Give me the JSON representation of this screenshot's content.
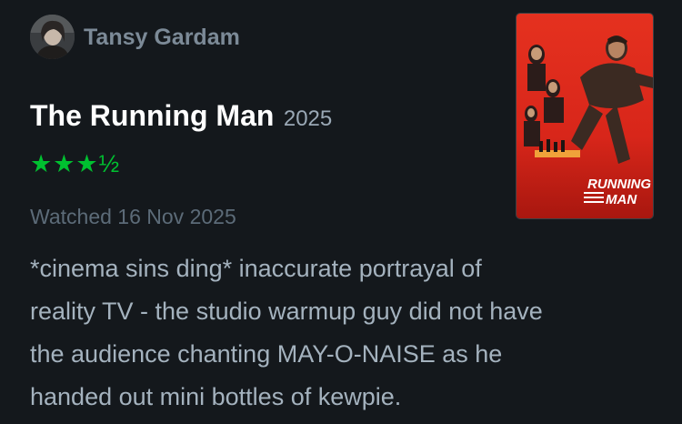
{
  "user": {
    "name": "Tansy Gardam",
    "avatar": "avatar"
  },
  "film": {
    "title": "The Running Man",
    "year": "2025",
    "rating": "★★★½",
    "poster_text_line1": "RUNNING",
    "poster_text_line2": "MAN"
  },
  "diary": {
    "watched": "Watched 16 Nov 2025"
  },
  "review": {
    "text": "*cinema sins ding* inaccurate portrayal of\nreality TV  - the studio warmup guy did not have\nthe audience chanting MAY-O-NAISE as he\nhanded out mini bottles of kewpie."
  },
  "colors": {
    "background": "#14181c",
    "rating_green": "#00c030",
    "poster_red": "#e0271d"
  }
}
